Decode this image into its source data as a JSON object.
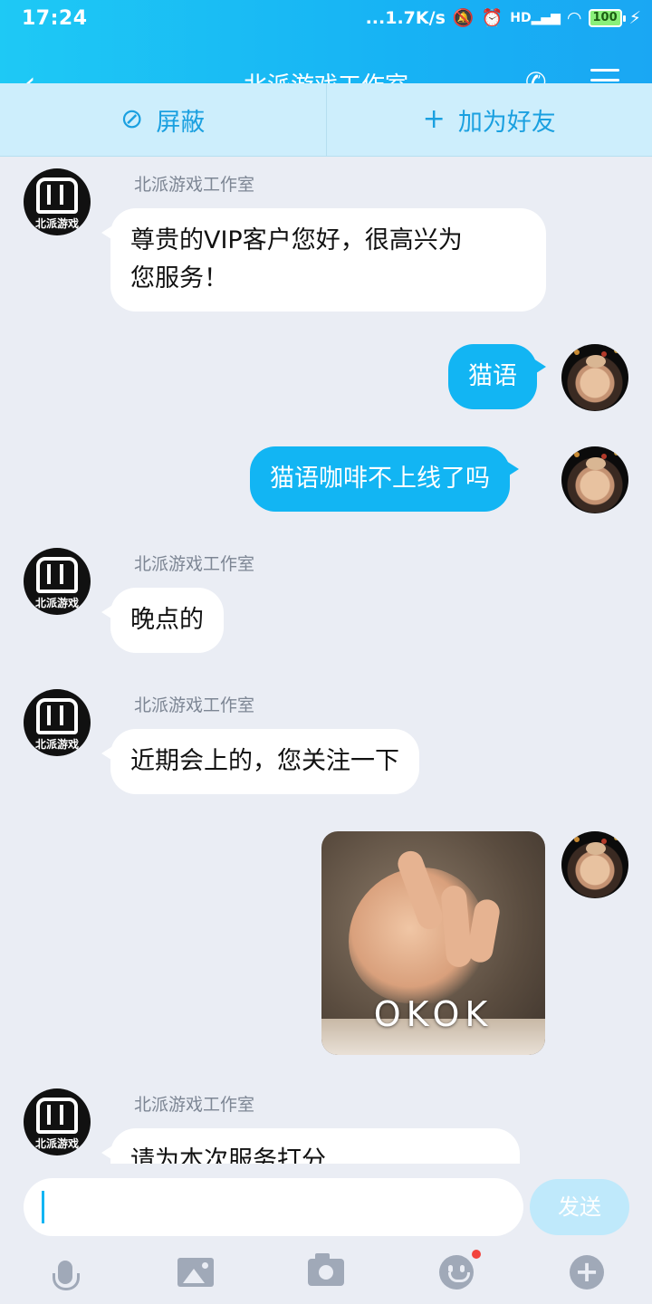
{
  "status_bar": {
    "time": "17:24",
    "net_speed": "...1.7K/s",
    "hd_label": "HD",
    "battery": "100"
  },
  "header": {
    "title": "北派游戏工作室",
    "back_icon": "back-arrow-icon",
    "call_icon": "phone-icon",
    "menu_icon": "menu-icon"
  },
  "actions": {
    "block_label": "屏蔽",
    "block_icon": "⊘",
    "add_friend_label": "加为好友",
    "add_friend_icon": "+"
  },
  "contact": {
    "name": "北派游戏工作室",
    "avatar_caption": "北派游戏"
  },
  "messages": [
    {
      "from": "them",
      "sender": "北派游戏工作室",
      "lines": [
        "尊贵的VIP客户您好，很高兴为",
        "您服务！"
      ]
    },
    {
      "from": "me",
      "text": "猫语"
    },
    {
      "from": "me",
      "text": "猫语咖啡不上线了吗"
    },
    {
      "from": "them",
      "sender": "北派游戏工作室",
      "text": "晚点的"
    },
    {
      "from": "them",
      "sender": "北派游戏工作室",
      "text": "近期会上的，您关注一下"
    },
    {
      "from": "me",
      "type": "sticker",
      "caption": "OKOK"
    },
    {
      "from": "them",
      "sender": "北派游戏工作室",
      "text": "请为本次服务打分"
    }
  ],
  "composer": {
    "send_label": "发送"
  },
  "colors": {
    "accent": "#12b5f3",
    "action_bar": "#cdeefc",
    "background": "#eaedf4",
    "notification_dot": "#f2443d"
  }
}
